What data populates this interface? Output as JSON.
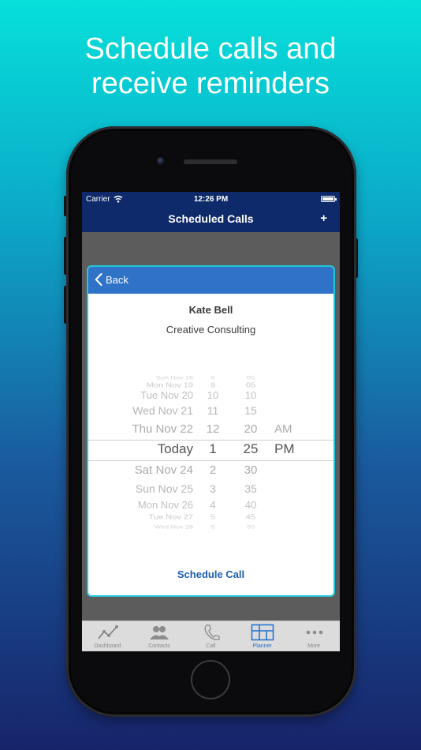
{
  "headline": {
    "line1": "Schedule calls and",
    "line2": "receive reminders"
  },
  "status_bar": {
    "carrier": "Carrier",
    "time": "12:26 PM"
  },
  "nav": {
    "title": "Scheduled Calls",
    "add_label": "+"
  },
  "dialog": {
    "back_label": "Back",
    "contact_name": "Kate Bell",
    "company": "Creative Consulting",
    "schedule_label": "Schedule Call"
  },
  "picker": {
    "rows": [
      {
        "date": "Sun Nov 18",
        "hour": "8",
        "minute": "00",
        "ampm": ""
      },
      {
        "date": "Mon Nov 19",
        "hour": "9",
        "minute": "05",
        "ampm": ""
      },
      {
        "date": "Tue Nov 20",
        "hour": "10",
        "minute": "10",
        "ampm": ""
      },
      {
        "date": "Wed Nov 21",
        "hour": "11",
        "minute": "15",
        "ampm": ""
      },
      {
        "date": "Thu Nov 22",
        "hour": "12",
        "minute": "20",
        "ampm": "AM"
      },
      {
        "date": "Today",
        "hour": "1",
        "minute": "25",
        "ampm": "PM"
      },
      {
        "date": "Sat Nov 24",
        "hour": "2",
        "minute": "30",
        "ampm": ""
      },
      {
        "date": "Sun Nov 25",
        "hour": "3",
        "minute": "35",
        "ampm": ""
      },
      {
        "date": "Mon Nov 26",
        "hour": "4",
        "minute": "40",
        "ampm": ""
      },
      {
        "date": "Tue Nov 27",
        "hour": "5",
        "minute": "45",
        "ampm": ""
      },
      {
        "date": "Wed Nov 28",
        "hour": "6",
        "minute": "50",
        "ampm": ""
      }
    ],
    "selected_index": 5
  },
  "tabs": [
    {
      "label": "Dashboard",
      "icon": "chart-line-icon"
    },
    {
      "label": "Contacts",
      "icon": "contacts-icon"
    },
    {
      "label": "Call",
      "icon": "phone-icon"
    },
    {
      "label": "Planner",
      "icon": "planner-grid-icon",
      "active": true
    },
    {
      "label": "More",
      "icon": "more-dots-icon"
    }
  ],
  "colors": {
    "nav_bg": "#0e2a6a",
    "dialog_header": "#2f73c8",
    "dialog_border": "#22c7d8",
    "accent": "#1f5fb0",
    "active_tab": "#1f6fd0"
  }
}
